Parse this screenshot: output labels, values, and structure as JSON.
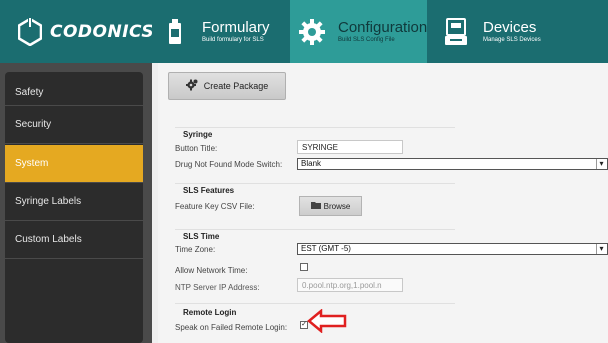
{
  "brand": {
    "name": "CODONICS"
  },
  "nav": {
    "formulary": {
      "title": "Formulary",
      "subtitle": "Build formulary for SLS"
    },
    "configuration": {
      "title": "Configuration",
      "subtitle": "Build SLS Config File"
    },
    "devices": {
      "title": "Devices",
      "subtitle": "Manage SLS Devices"
    }
  },
  "sidebar": {
    "items": [
      {
        "label": "Safety",
        "active": false
      },
      {
        "label": "Security",
        "active": false
      },
      {
        "label": "System",
        "active": true
      },
      {
        "label": "Syringe Labels",
        "active": false
      },
      {
        "label": "Custom Labels",
        "active": false
      }
    ]
  },
  "main": {
    "create_package_label": "Create Package",
    "syringe": {
      "title": "Syringe",
      "button_title_label": "Button Title:",
      "button_title_value": "SYRINGE",
      "drug_not_found_label": "Drug Not Found Mode Switch:",
      "drug_not_found_value": "Blank"
    },
    "sls_features": {
      "title": "SLS Features",
      "feature_key_label": "Feature Key CSV File:",
      "browse_label": "Browse"
    },
    "sls_time": {
      "title": "SLS Time",
      "time_zone_label": "Time Zone:",
      "time_zone_value": "EST (GMT -5)",
      "allow_network_time_label": "Allow Network Time:",
      "allow_network_time_checked": false,
      "ntp_label": "NTP Server IP Address:",
      "ntp_value": "0.pool.ntp.org,1.pool.n"
    },
    "remote_login": {
      "title": "Remote Login",
      "speak_label": "Speak on Failed Remote Login:",
      "speak_checked": true,
      "check_mark": "✓"
    }
  },
  "colors": {
    "header_bg": "#1b6d70",
    "active_tab_bg": "#2e9c98",
    "active_sidebar": "#e5a921",
    "sidebar_bg": "#2c2c2c",
    "callout_arrow": "#e02020"
  }
}
